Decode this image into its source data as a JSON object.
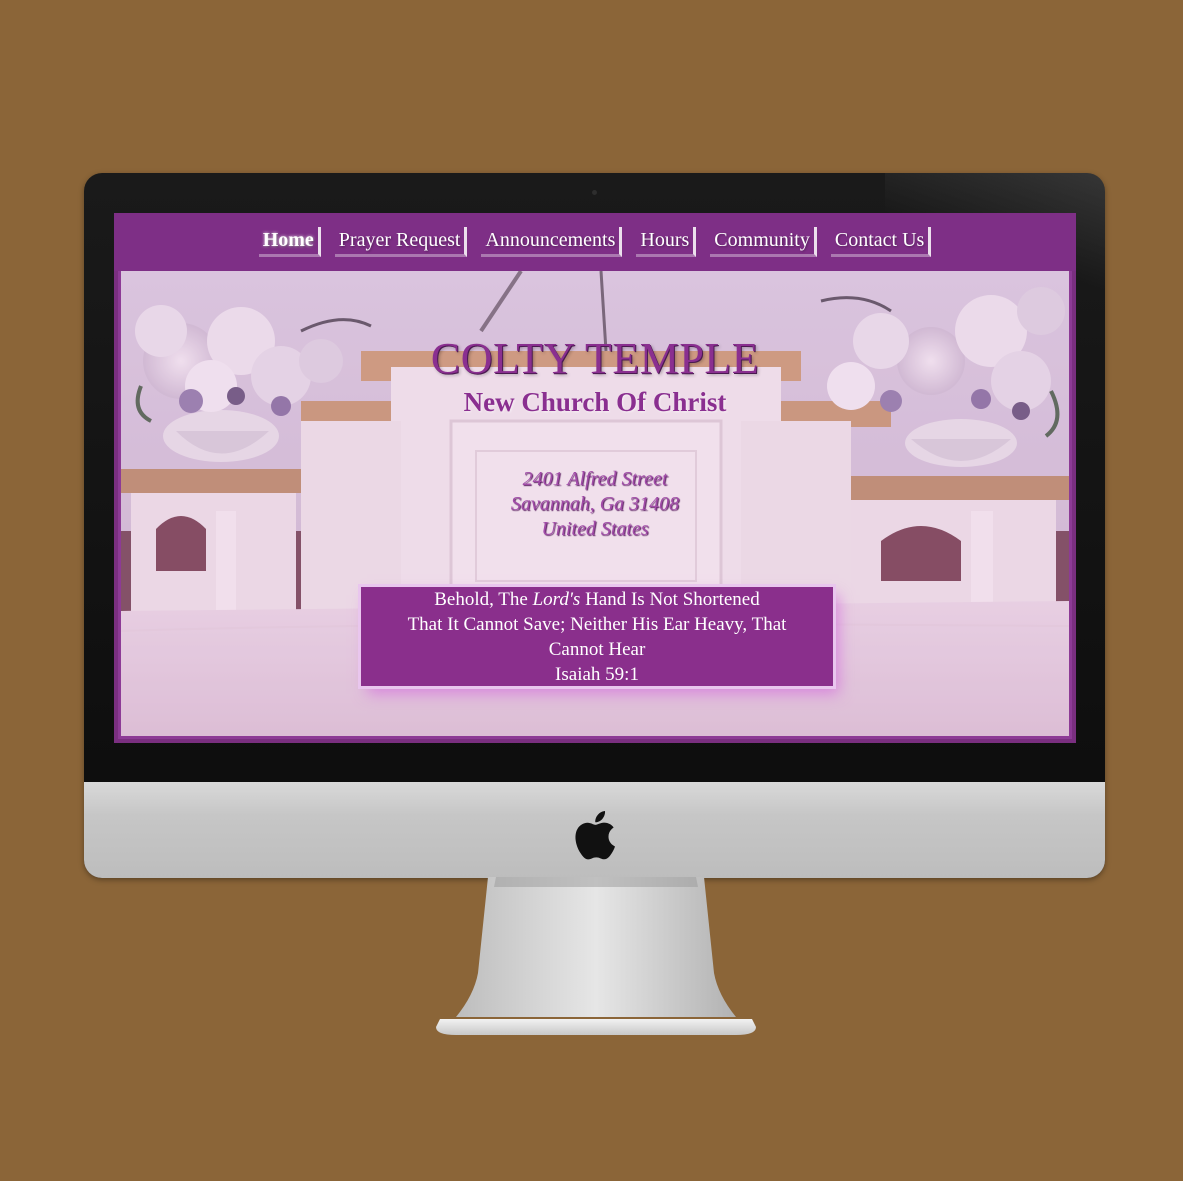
{
  "nav": {
    "items": [
      {
        "label": "Home",
        "active": true
      },
      {
        "label": "Prayer Request",
        "active": false
      },
      {
        "label": "Announcements",
        "active": false
      },
      {
        "label": "Hours",
        "active": false
      },
      {
        "label": "Community",
        "active": false
      },
      {
        "label": "Contact Us",
        "active": false
      }
    ]
  },
  "hero": {
    "title": "COLTY TEMPLE",
    "subtitle": "New Church Of Christ",
    "address": {
      "line1": "2401 Alfred Street",
      "line2": "Savannah, Ga 31408",
      "line3": "United States"
    },
    "verse": {
      "part1": "Behold, The ",
      "emphasis": "Lord's",
      "part2": " Hand Is Not Shortened",
      "line2": "That It Cannot Save; Neither His Ear Heavy, That",
      "line3": "Cannot Hear",
      "reference": "Isaiah 59:1"
    }
  },
  "colors": {
    "background": "#8b6538",
    "brand_purple": "#7e2f86",
    "title_purple": "#8a2f90",
    "verse_bg": "#8a2f8c"
  },
  "icons": {
    "monitor_logo": "apple-logo-icon"
  }
}
